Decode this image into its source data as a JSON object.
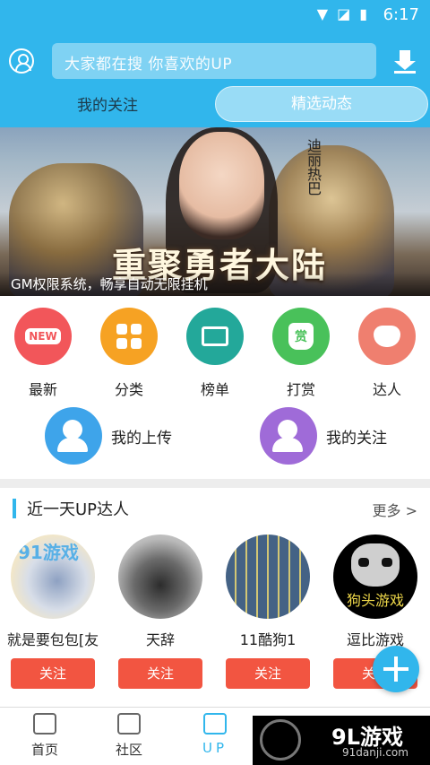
{
  "status_bar": {
    "time": "6:17"
  },
  "header": {
    "search_placeholder": "大家都在搜  你喜欢的UP",
    "tabs": [
      {
        "label": "我的关注",
        "active": false
      },
      {
        "label": "精选动态",
        "active": true
      }
    ]
  },
  "banner": {
    "title": "重聚勇者大陆",
    "vertical_text": "迪丽热巴",
    "caption": "GM权限系统，畅享自动无限挂机"
  },
  "categories": [
    {
      "label": "最新",
      "icon": "new-badge-icon",
      "color": "#f2565a",
      "icon_text": "NEW"
    },
    {
      "label": "分类",
      "icon": "grid-icon",
      "color": "#f6a223"
    },
    {
      "label": "榜单",
      "icon": "certificate-icon",
      "color": "#23a89a"
    },
    {
      "label": "打赏",
      "icon": "money-bag-icon",
      "color": "#49c15a",
      "icon_text": "赏"
    },
    {
      "label": "达人",
      "icon": "mask-icon",
      "color": "#ef7f6f"
    }
  ],
  "quick_links": [
    {
      "label": "我的上传",
      "icon": "upload-user-icon",
      "color": "#3ea4ea"
    },
    {
      "label": "我的关注",
      "icon": "star-user-icon",
      "color": "#9f6bd8"
    }
  ],
  "up_section": {
    "title": "近一天UP达人",
    "more": "更多 >",
    "users": [
      {
        "name": "就是要包包[友",
        "follow": "关注",
        "avatar_text": "91游戏"
      },
      {
        "name": "天辞",
        "follow": "关注"
      },
      {
        "name": "11酷狗1",
        "follow": "关注"
      },
      {
        "name": "逗比游戏",
        "follow": "关注",
        "avatar_text": "狗头游戏"
      }
    ]
  },
  "bottom_nav": [
    {
      "label": "首页",
      "active": false
    },
    {
      "label": "社区",
      "active": false
    },
    {
      "label": "UP",
      "active": true
    }
  ],
  "watermark": {
    "main": "9L游戏",
    "sub": "91danji.com"
  },
  "colors": {
    "primary": "#31b6ec",
    "follow_button": "#f25541"
  }
}
